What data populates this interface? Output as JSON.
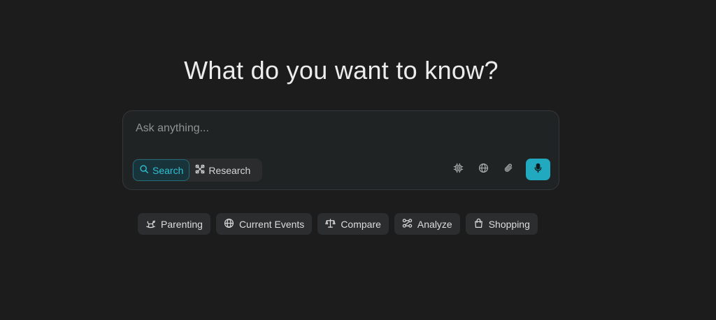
{
  "headline": "What do you want to know?",
  "ask": {
    "placeholder": "Ask anything...",
    "value": ""
  },
  "modes": [
    {
      "label": "Search",
      "icon": "search-icon",
      "active": true
    },
    {
      "label": "Research",
      "icon": "research-icon",
      "active": false
    }
  ],
  "tools": [
    {
      "icon": "model-chip-icon"
    },
    {
      "icon": "globe-icon"
    },
    {
      "icon": "paperclip-icon"
    },
    {
      "icon": "microphone-icon"
    }
  ],
  "chips": [
    {
      "label": "Parenting",
      "icon": "rocking-horse-icon"
    },
    {
      "label": "Current Events",
      "icon": "globe-icon"
    },
    {
      "label": "Compare",
      "icon": "scales-icon"
    },
    {
      "label": "Analyze",
      "icon": "nodes-icon"
    },
    {
      "label": "Shopping",
      "icon": "shopping-bag-icon"
    }
  ],
  "colors": {
    "background": "#1c1c1c",
    "accent": "#20a9bf",
    "active_mode_text": "#2fc1d4"
  }
}
